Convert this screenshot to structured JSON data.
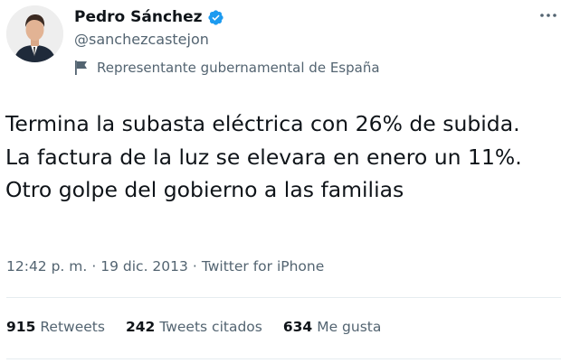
{
  "author": {
    "display_name": "Pedro Sánchez",
    "handle": "@sanchezcastejon",
    "label": "Representante gubernamental de España",
    "verified": true
  },
  "tweet": {
    "text": "Termina la subasta eléctrica con 26% de subida. La factura de la luz se elevara en enero un 11%. Otro golpe del gobierno a las familias",
    "time": "12:42 p. m.",
    "date": "19 dic. 2013",
    "source": "Twitter for iPhone",
    "separator": "·"
  },
  "stats": {
    "retweets_count": "915",
    "retweets_label": "Retweets",
    "quotes_count": "242",
    "quotes_label": "Tweets citados",
    "likes_count": "634",
    "likes_label": "Me gusta"
  },
  "colors": {
    "verified_badge": "#1d9bf0",
    "secondary_text": "#536471",
    "primary_text": "#0f1419",
    "divider": "#e6ecf0"
  },
  "icons": {
    "verified": "verified-badge-icon",
    "label": "flag-icon",
    "more": "more-options-icon"
  }
}
